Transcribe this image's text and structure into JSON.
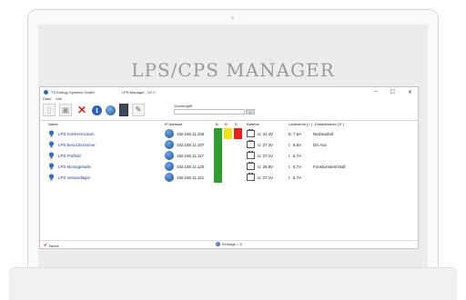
{
  "hero": {
    "title": "LPS/CPS MANAGER"
  },
  "window": {
    "app_title": "TS Energy Systems GmbH",
    "subtitle": "LPS-Manager - V2.0",
    "controls": {
      "minimize": "–",
      "maximize": "☐",
      "close": "✕"
    }
  },
  "menu": {
    "items": [
      "Datei",
      "Info"
    ]
  },
  "toolbar": {
    "search_label": "Suchbegriff",
    "search_value": "",
    "search_button": "⌕"
  },
  "columns": {
    "name": "Name",
    "ip": "IP Adresse",
    "s1": "B",
    "s2": "B",
    "s3": "S",
    "battery": "Batterie",
    "current": "Ladestrom [ ! ] - Entladestrom [ E ]"
  },
  "rows": [
    {
      "name": "LPS Konferenzraum",
      "ip": "192.168.11.105",
      "status": [
        "#2e9f2a",
        "#f2e01a",
        "#e8211b"
      ],
      "voltage": "U: 24.4V",
      "dir": "E:",
      "current": "7.6A",
      "message": "Netzausfall"
    },
    {
      "name": "LPS Besuchszimmer",
      "ip": "192.168.11.107",
      "status": [
        "#2e9f2a",
        "",
        ""
      ],
      "voltage": "U: 27.3V",
      "dir": "I:",
      "current": "8.6A",
      "message": "DS Aus"
    },
    {
      "name": "LPS Prüffeld",
      "ip": "192.168.11.117",
      "status": [
        "#2e9f2a",
        "",
        ""
      ],
      "voltage": "U: 27.1V",
      "dir": "I:",
      "current": "6.7A",
      "message": ""
    },
    {
      "name": "LPS Montagehalle",
      "ip": "192.168.11.120",
      "status": [
        "#2e9f2a",
        "",
        ""
      ],
      "voltage": "U: 26.8V",
      "dir": "I:",
      "current": "6.7A",
      "message": "Funktionstest läuft"
    },
    {
      "name": "LPS Versandlager",
      "ip": "192.168.11.121",
      "status": [
        "#2e9f2a",
        "",
        ""
      ],
      "voltage": "U: 27.1V",
      "dir": "I:",
      "current": "6.7A",
      "message": ""
    }
  ],
  "status": {
    "ready": "Bereit",
    "entries": "Einträge = 5"
  },
  "icons": [
    "lightbulb-icon",
    "globe-icon",
    "info-icon",
    "delete-icon",
    "battery-icon",
    "check-icon"
  ]
}
